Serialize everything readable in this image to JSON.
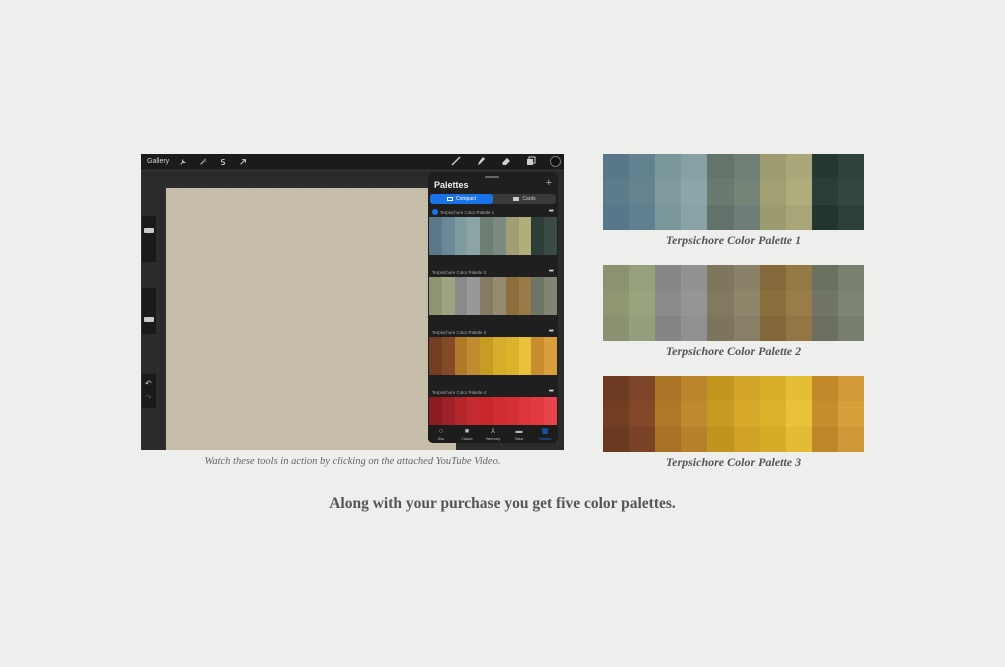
{
  "app": {
    "toolbar": {
      "gallery_label": "Gallery",
      "left_icons": [
        "wrench-icon",
        "magic-wand-icon",
        "selection-icon",
        "transform-arrow-icon"
      ],
      "right_icons": [
        "brush-icon",
        "smudge-icon",
        "eraser-icon",
        "layers-icon"
      ],
      "current_color": "#111111"
    },
    "panel": {
      "title": "Palettes",
      "add_label": "+",
      "segments": [
        {
          "label": "Compact",
          "active": true
        },
        {
          "label": "Cards",
          "active": false
        }
      ],
      "palettes": [
        {
          "name": "Terpsichore Color Palette 1",
          "default": true,
          "colors": [
            "#5a7a8c",
            "#6b8896",
            "#7e9ca0",
            "#8da4a6",
            "#6e7e75",
            "#7c8a81",
            "#a09f73",
            "#b1ae7c",
            "#2d3d38",
            "#394b44"
          ]
        },
        {
          "name": "Terpsichore Color Palette 3",
          "default": false,
          "colors": [
            "#8e9472",
            "#9ca57f",
            "#8a8a8a",
            "#989898",
            "#847c62",
            "#948b6c",
            "#8a6e3e",
            "#9a7a47",
            "#6f7564",
            "#7f8572"
          ]
        },
        {
          "name": "Terpsichore Color Palette 2",
          "default": false,
          "colors": [
            "#733d22",
            "#834a2a",
            "#b07a2a",
            "#c08a2e",
            "#c79c22",
            "#d6ac2a",
            "#dcb22a",
            "#e8c23a",
            "#c88d2c",
            "#d8a03a"
          ]
        },
        {
          "name": "Terpsichore Color Palette 4",
          "default": false,
          "colors": [
            "#8a1c22",
            "#9e2128",
            "#b3262c",
            "#c42a31",
            "#c8262c",
            "#d22c33",
            "#d23036",
            "#de353c",
            "#e23a3f",
            "#e8444a"
          ]
        }
      ],
      "nav": [
        {
          "label": "Disc",
          "icon": "disc-icon",
          "active": false
        },
        {
          "label": "Classic",
          "icon": "classic-icon",
          "active": false
        },
        {
          "label": "Harmony",
          "icon": "harmony-icon",
          "active": false
        },
        {
          "label": "Value",
          "icon": "value-icon",
          "active": false
        },
        {
          "label": "Palettes",
          "icon": "palettes-grid-icon",
          "active": true
        }
      ]
    }
  },
  "caption": "Watch these tools in action by clicking on the attached YouTube Video.",
  "headline": "Along with your purchase you get five color palettes.",
  "big_palettes": [
    {
      "label": "Terpsichore Color Palette 1",
      "swatches": [
        [
          "#58788a",
          "#62828f",
          "#5c7b8b",
          "#64838f",
          "#55788a",
          "#5f808e"
        ],
        [
          "#7a979c",
          "#86a0a4",
          "#7f9b9f",
          "#8ca5a8",
          "#7a979c",
          "#88a2a6"
        ],
        [
          "#647468",
          "#707f75",
          "#6a7a6f",
          "#768478",
          "#62726a",
          "#6e7d75"
        ],
        [
          "#9e9c70",
          "#aaa87a",
          "#a29f73",
          "#b0ad7d",
          "#9c9a6f",
          "#a8a578"
        ],
        [
          "#263832",
          "#2f423b",
          "#2b3e37",
          "#33463f",
          "#243530",
          "#2d3f39"
        ]
      ]
    },
    {
      "label": "Terpsichore Color Palette 2",
      "swatches": [
        [
          "#8c9270",
          "#96a07b",
          "#8e9672",
          "#99a37e",
          "#8a9170",
          "#959f7b"
        ],
        [
          "#868686",
          "#929292",
          "#8a8a8a",
          "#959595",
          "#848484",
          "#909090"
        ],
        [
          "#7e765d",
          "#8a8268",
          "#827a60",
          "#8e866b",
          "#7c745c",
          "#887f66"
        ],
        [
          "#85693a",
          "#957945",
          "#8a6e3e",
          "#9a7c48",
          "#836738",
          "#937643"
        ],
        [
          "#6b7161",
          "#7a8070",
          "#707565",
          "#7e8473",
          "#6a6f60",
          "#787e6f"
        ]
      ]
    },
    {
      "label": "Terpsichore Color Palette 3",
      "swatches": [
        [
          "#6e3a21",
          "#7e4528",
          "#733d23",
          "#83482a",
          "#6b3820",
          "#7a4326"
        ],
        [
          "#aa7427",
          "#b9842c",
          "#ae7829",
          "#be892f",
          "#a77126",
          "#b6812b"
        ],
        [
          "#c29720",
          "#d2a528",
          "#c79b22",
          "#d6a92a",
          "#bf941f",
          "#cfa227"
        ],
        [
          "#d8ae28",
          "#e6be36",
          "#dcb22a",
          "#eac23a",
          "#d6ab27",
          "#e4bb34"
        ],
        [
          "#c2882a",
          "#d29a37",
          "#c88d2c",
          "#d8a03a",
          "#bf8529",
          "#cf9735"
        ]
      ]
    }
  ]
}
